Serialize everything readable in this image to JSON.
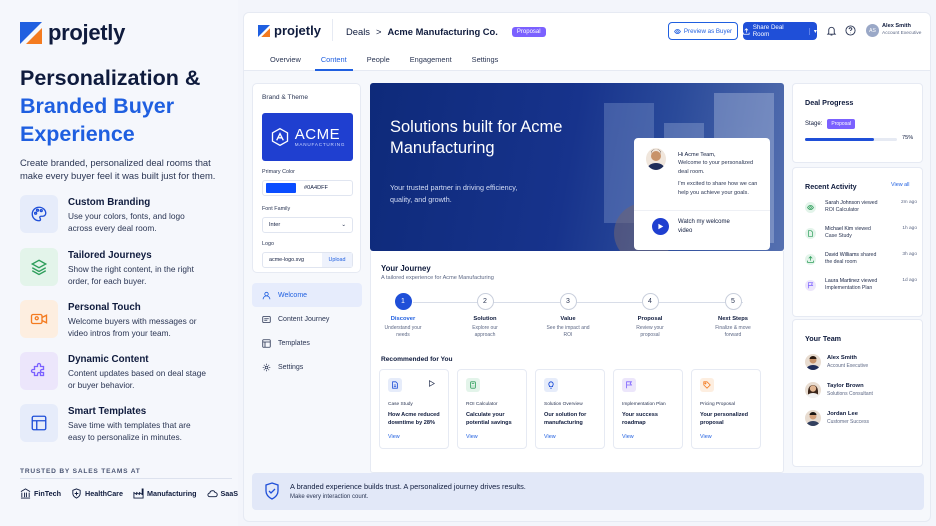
{
  "brand": {
    "name": "projetly",
    "accent": "#1f5fe0",
    "accent_dark": "#1f4fd8",
    "badge_color": "#7b61ff"
  },
  "marketing": {
    "headline_line1": "Personalization &",
    "headline_line2": "Branded Buyer",
    "headline_line3": "Experience",
    "subtext": "Create branded, personalized deal rooms that make every buyer feel it was built just for them.",
    "features": [
      {
        "title": "Custom Branding",
        "desc": "Use your colors, fonts, and logo across every deal room.",
        "icon": "palette-icon"
      },
      {
        "title": "Tailored Journeys",
        "desc": "Show the right content, in the right order, for each buyer.",
        "icon": "layers-icon"
      },
      {
        "title": "Personal Touch",
        "desc": "Welcome buyers with messages or video intros from your team.",
        "icon": "video-icon"
      },
      {
        "title": "Dynamic Content",
        "desc": "Content updates based on deal stage or buyer behavior.",
        "icon": "puzzle-icon"
      },
      {
        "title": "Smart Templates",
        "desc": "Save time with templates that are easy to personalize in minutes.",
        "icon": "template-icon"
      }
    ],
    "trusted_label": "TRUSTED BY SALES TEAMS AT",
    "trusted_logos": [
      "FinTech",
      "HealthCare",
      "Manufacturing",
      "SaaS"
    ]
  },
  "app": {
    "logo": "projetly",
    "breadcrumb": {
      "section": "Deals",
      "separator": ">",
      "deal": "Acme Manufacturing Co.",
      "status": "Proposal"
    },
    "preview_button": "Preview as Buyer",
    "share_button": "Share Deal Room",
    "user": {
      "name": "Alex Smith",
      "role": "Account Executive",
      "initials": "AS"
    },
    "tabs": [
      "Overview",
      "Content",
      "People",
      "Engagement",
      "Settings"
    ],
    "active_tab": "Content",
    "brand_theme": {
      "title": "Brand & Theme",
      "acme_name": "ACME",
      "acme_sub": "MANUFACTURING",
      "primary_color_label": "Primary Color",
      "primary_color": "#0A4DFF",
      "font_family_label": "Font Family",
      "font_family": "Inter",
      "logo_label": "Logo",
      "logo_file": "acme-logo.svg",
      "upload_label": "Upload"
    },
    "nav": [
      {
        "label": "Welcome",
        "icon": "user-icon",
        "active": true
      },
      {
        "label": "Content Journey",
        "icon": "journey-icon",
        "active": false
      },
      {
        "label": "Templates",
        "icon": "template-icon",
        "active": false
      },
      {
        "label": "Settings",
        "icon": "gear-icon",
        "active": false
      }
    ],
    "hero": {
      "title": "Solutions built for Acme Manufacturing",
      "subtitle": "Your trusted partner in driving efficiency, quality, and growth.",
      "greeting": "Hi Acme Team,",
      "message1": "Welcome to your personalized deal room.",
      "message2": "I'm excited to share how we can help you achieve your goals.",
      "video_label": "Watch my welcome video"
    },
    "journey": {
      "title": "Your Journey",
      "subtitle": "A tailored experience for Acme Manufacturing",
      "steps": [
        {
          "num": "1",
          "name": "Discover",
          "desc": "Understand your needs",
          "active": true
        },
        {
          "num": "2",
          "name": "Solution",
          "desc": "Explore our approach",
          "active": false
        },
        {
          "num": "3",
          "name": "Value",
          "desc": "See the impact and ROI",
          "active": false
        },
        {
          "num": "4",
          "name": "Proposal",
          "desc": "Review your proposal",
          "active": false
        },
        {
          "num": "5",
          "name": "Next Steps",
          "desc": "Finalize & move forward",
          "active": false
        }
      ],
      "recommended_title": "Recommended for You",
      "recommended": [
        {
          "category": "Case Study",
          "name": "How Acme reduced downtime by 28%",
          "view": "View",
          "icon": "document-icon"
        },
        {
          "category": "ROI Calculator",
          "name": "Calculate your potential savings",
          "view": "View",
          "icon": "calculator-icon"
        },
        {
          "category": "Solution Overview",
          "name": "Our solution for manufacturing",
          "view": "View",
          "icon": "lightbulb-icon"
        },
        {
          "category": "Implementation Plan",
          "name": "Your success roadmap",
          "view": "View",
          "icon": "flag-icon"
        },
        {
          "category": "Pricing Proposal",
          "name": "Your personalized proposal",
          "view": "View",
          "icon": "tag-icon"
        }
      ]
    },
    "deal_progress": {
      "title": "Deal Progress",
      "stage_label": "Stage:",
      "stage": "Proposal",
      "percent_label": "75%",
      "percent": 75
    },
    "recent_activity": {
      "title": "Recent Activity",
      "view_all": "View all",
      "items": [
        {
          "who": "Sarah Johnson",
          "action": "viewed",
          "target": "ROI Calculator",
          "time": "2m ago"
        },
        {
          "who": "Michael Kim",
          "action": "viewed",
          "target": "Case Study",
          "time": "1h ago"
        },
        {
          "who": "David Williams",
          "action": "shared",
          "target": "the deal room",
          "time": "3h ago"
        },
        {
          "who": "Laura Martinez",
          "action": "viewed",
          "target": "Implementation Plan",
          "time": "1d ago"
        }
      ]
    },
    "team": {
      "title": "Your Team",
      "members": [
        {
          "name": "Alex Smith",
          "role": "Account Executive"
        },
        {
          "name": "Taylor Brown",
          "role": "Solutions Consultant"
        },
        {
          "name": "Jordan Lee",
          "role": "Customer Success"
        }
      ]
    },
    "banner": {
      "title": "A branded experience builds trust. A personalized journey drives results.",
      "subtitle": "Make every interaction count."
    }
  }
}
